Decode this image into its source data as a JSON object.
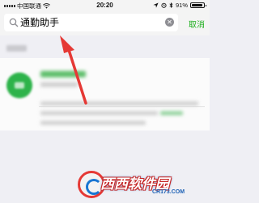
{
  "status_bar": {
    "carrier": "中国联通",
    "time": "20:20",
    "battery_text": "91%",
    "battery_level": 0.91
  },
  "search": {
    "query": "通勤助手",
    "cancel_label": "取消"
  },
  "watermark": {
    "brand": "西西软件园",
    "url": "CR173.COM"
  },
  "colors": {
    "accent": "#1aad19",
    "arrow": "#e53935"
  }
}
